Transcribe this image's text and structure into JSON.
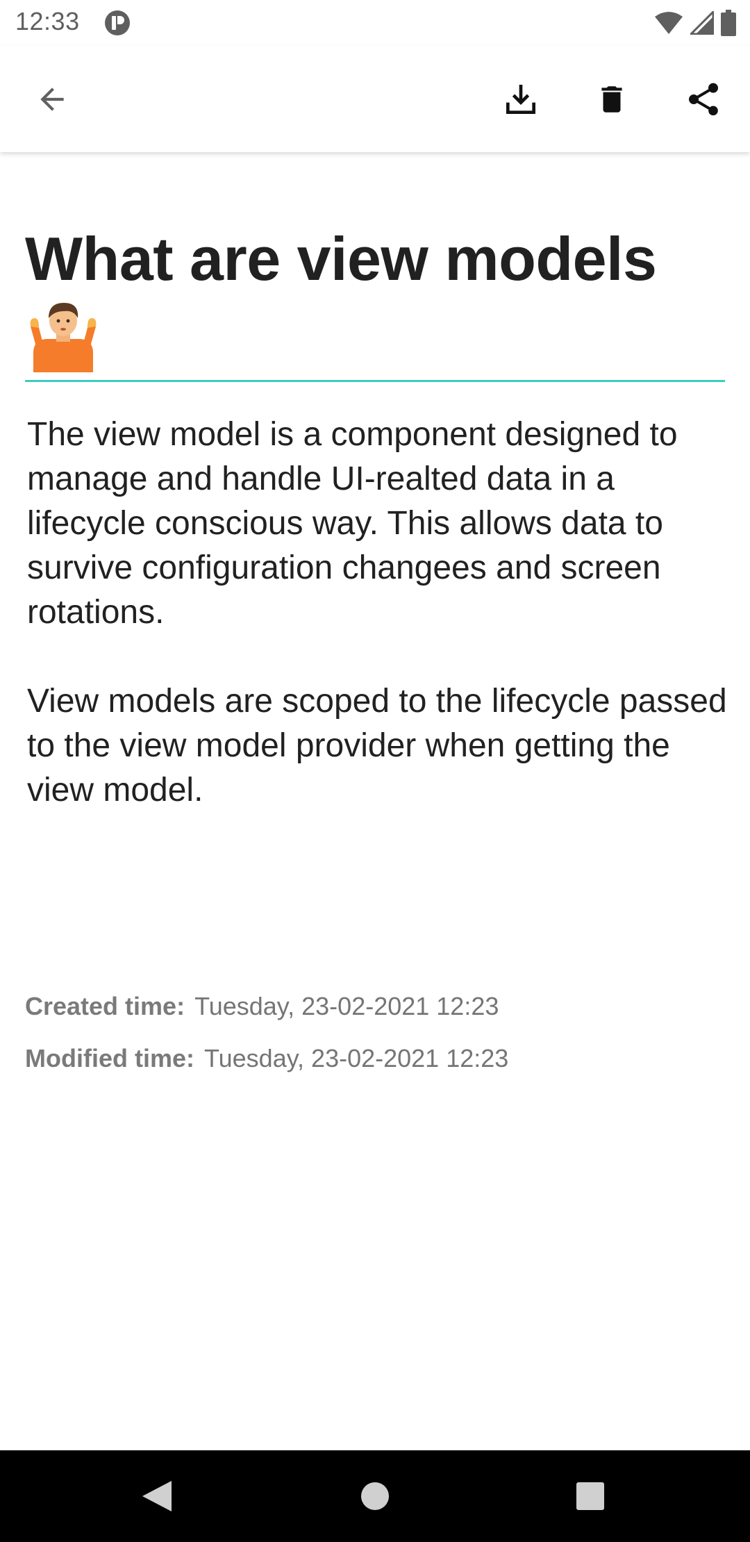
{
  "status_bar": {
    "time": "12:33",
    "icons": [
      "app-notification-icon",
      "wifi-icon",
      "cell-signal-icon",
      "battery-icon"
    ]
  },
  "toolbar": {
    "icons": [
      "back-arrow-icon",
      "download-icon",
      "delete-icon",
      "share-icon"
    ]
  },
  "note": {
    "title": "What are view models",
    "title_emoji": "person-shrugging-emoji",
    "body": "The view model is a component designed to manage and handle UI-realted data in a lifecycle conscious way. This allows data to survive configuration changees and screen rotations.\n\nView models are scoped to the lifecycle passed to the view model provider when getting the view model.",
    "created_label": "Created time:",
    "created_value": "Tuesday, 23-02-2021 12:23",
    "modified_label": "Modified time:",
    "modified_value": "Tuesday, 23-02-2021 12:23"
  },
  "colors": {
    "accent_underline": "#3ccdbf",
    "title_text": "#212121",
    "meta_text": "#757575",
    "nav_bar": "#000000"
  },
  "nav_bar": {
    "icons": [
      "nav-back-icon",
      "nav-home-icon",
      "nav-recents-icon"
    ]
  }
}
